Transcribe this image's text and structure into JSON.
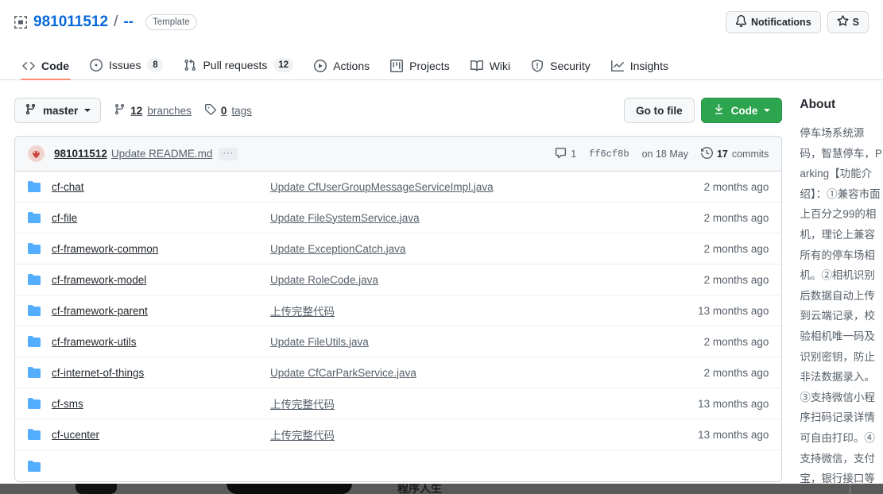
{
  "header": {
    "repo_icon": "repo-template-icon",
    "owner": "981011512",
    "separator": "/",
    "name": "--",
    "template_badge": "Template",
    "notifications_label": "Notifications",
    "star_label": "S"
  },
  "nav": {
    "tabs": [
      {
        "label": "Code",
        "icon": "code-icon",
        "count": null,
        "selected": true
      },
      {
        "label": "Issues",
        "icon": "issue-opened-icon",
        "count": "8",
        "selected": false
      },
      {
        "label": "Pull requests",
        "icon": "git-pull-request-icon",
        "count": "12",
        "selected": false
      },
      {
        "label": "Actions",
        "icon": "play-icon",
        "count": null,
        "selected": false
      },
      {
        "label": "Projects",
        "icon": "project-icon",
        "count": null,
        "selected": false
      },
      {
        "label": "Wiki",
        "icon": "book-icon",
        "count": null,
        "selected": false
      },
      {
        "label": "Security",
        "icon": "shield-icon",
        "count": null,
        "selected": false
      },
      {
        "label": "Insights",
        "icon": "graph-icon",
        "count": null,
        "selected": false
      }
    ]
  },
  "branch_bar": {
    "branch": "master",
    "branches_count": "12",
    "branches_label": "branches",
    "tags_count": "0",
    "tags_label": "tags",
    "go_to_file": "Go to file",
    "code_button": "Code"
  },
  "latest_commit": {
    "author": "981011512",
    "message": "Update README.md",
    "ellipsis": "…",
    "comments": "1",
    "sha": "ff6cf8b",
    "date": "on 18 May",
    "commits_count": "17",
    "commits_word": "commits"
  },
  "files": [
    {
      "icon": "folder-icon",
      "name": "cf-chat",
      "message": "Update CfUserGroupMessageServiceImpl.java",
      "age": "2 months ago"
    },
    {
      "icon": "folder-icon",
      "name": "cf-file",
      "message": "Update FileSystemService.java",
      "age": "2 months ago"
    },
    {
      "icon": "folder-icon",
      "name": "cf-framework-common",
      "message": "Update ExceptionCatch.java",
      "age": "2 months ago"
    },
    {
      "icon": "folder-icon",
      "name": "cf-framework-model",
      "message": "Update RoleCode.java",
      "age": "2 months ago"
    },
    {
      "icon": "folder-icon",
      "name": "cf-framework-parent",
      "message": "上传完整代码",
      "age": "13 months ago"
    },
    {
      "icon": "folder-icon",
      "name": "cf-framework-utils",
      "message": "Update FileUtils.java",
      "age": "2 months ago"
    },
    {
      "icon": "folder-icon",
      "name": "cf-internet-of-things",
      "message": "Update CfCarParkService.java",
      "age": "2 months ago"
    },
    {
      "icon": "folder-icon",
      "name": "cf-sms",
      "message": "上传完整代码",
      "age": "13 months ago"
    },
    {
      "icon": "folder-icon",
      "name": "cf-ucenter",
      "message": "上传完整代码",
      "age": "13 months ago"
    }
  ],
  "about": {
    "title": "About",
    "description": "停车场系统源码，智慧停车，Parking【功能介绍】：①兼容市面上百分之99的相机，理论上兼容所有的停车场相机。②相机识别后数据自动上传到云端记录，校验相机唯一码及识别密钥，防止非法数据录入。③支持微信小程序扫码记录详情可自由打印。④支持微信，支付宝，银行接口等多种支付方式。⑤可绑定不同的商户进行分成结算。⑥支持免费时间内全免。⑦支持手机app在线查询附近停车场。⑧支持手机app查询停车场费用，优惠信息等。⑨支持手机app预约车位。⑩支持车主用户注册，用户app可接管车牌号并进行扫码支付出入。【技术栈】：后端采用java，框架"
  },
  "colors": {
    "accent_blue": "#0969da",
    "green_button": "#2da44e",
    "tab_underline": "#fd8c73",
    "folder_blue": "#54aeff",
    "muted_text": "#57606a"
  }
}
